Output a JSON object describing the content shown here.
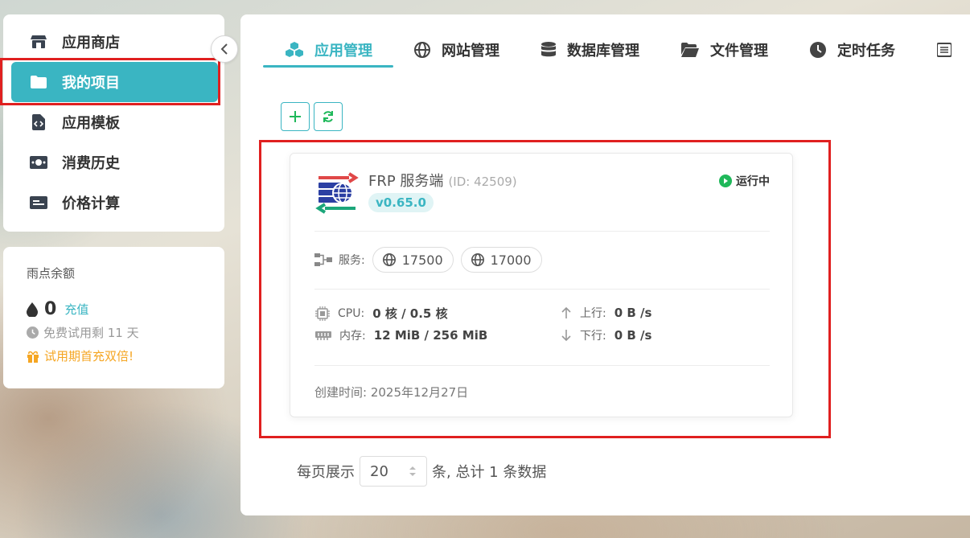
{
  "sidebar": {
    "items": [
      {
        "label": "应用商店",
        "icon": "store-icon"
      },
      {
        "label": "我的项目",
        "icon": "folder-icon",
        "active": true
      },
      {
        "label": "应用模板",
        "icon": "file-code-icon"
      },
      {
        "label": "消费历史",
        "icon": "money-bill-icon"
      },
      {
        "label": "价格计算",
        "icon": "calculator-card-icon"
      }
    ]
  },
  "balance": {
    "title": "雨点余额",
    "amount": "0",
    "recharge_label": "充值",
    "trial_text": "免费试用剩 11 天",
    "promo_text": "试用期首充双倍!"
  },
  "tabs": [
    {
      "label": "应用管理",
      "icon": "cubes-icon",
      "active": true
    },
    {
      "label": "网站管理",
      "icon": "globe-icon"
    },
    {
      "label": "数据库管理",
      "icon": "database-icon"
    },
    {
      "label": "文件管理",
      "icon": "folder-open-icon"
    },
    {
      "label": "定时任务",
      "icon": "clock-icon"
    },
    {
      "label": "",
      "icon": "list-icon"
    }
  ],
  "card": {
    "name": "FRP 服务端",
    "id_text": "(ID: 42509)",
    "version": "v0.65.0",
    "status": "运行中",
    "services_label": "服务:",
    "ports": [
      "17500",
      "17000"
    ],
    "cpu_label": "CPU:",
    "cpu_value": "0 核 / 0.5 核",
    "mem_label": "内存:",
    "mem_value": "12 MiB / 256 MiB",
    "up_label": "上行:",
    "up_value": "0 B /s",
    "down_label": "下行:",
    "down_value": "0 B /s",
    "created": "创建时间: 2025年12月27日"
  },
  "pagination": {
    "per_page_label": "每页展示",
    "per_page_value": "20",
    "summary": "条, 总计 1 条数据"
  },
  "colors": {
    "accent": "#3ab5c2",
    "highlight_box": "#e02020",
    "status_green": "#1fb85a",
    "promo_orange": "#f5a623"
  }
}
